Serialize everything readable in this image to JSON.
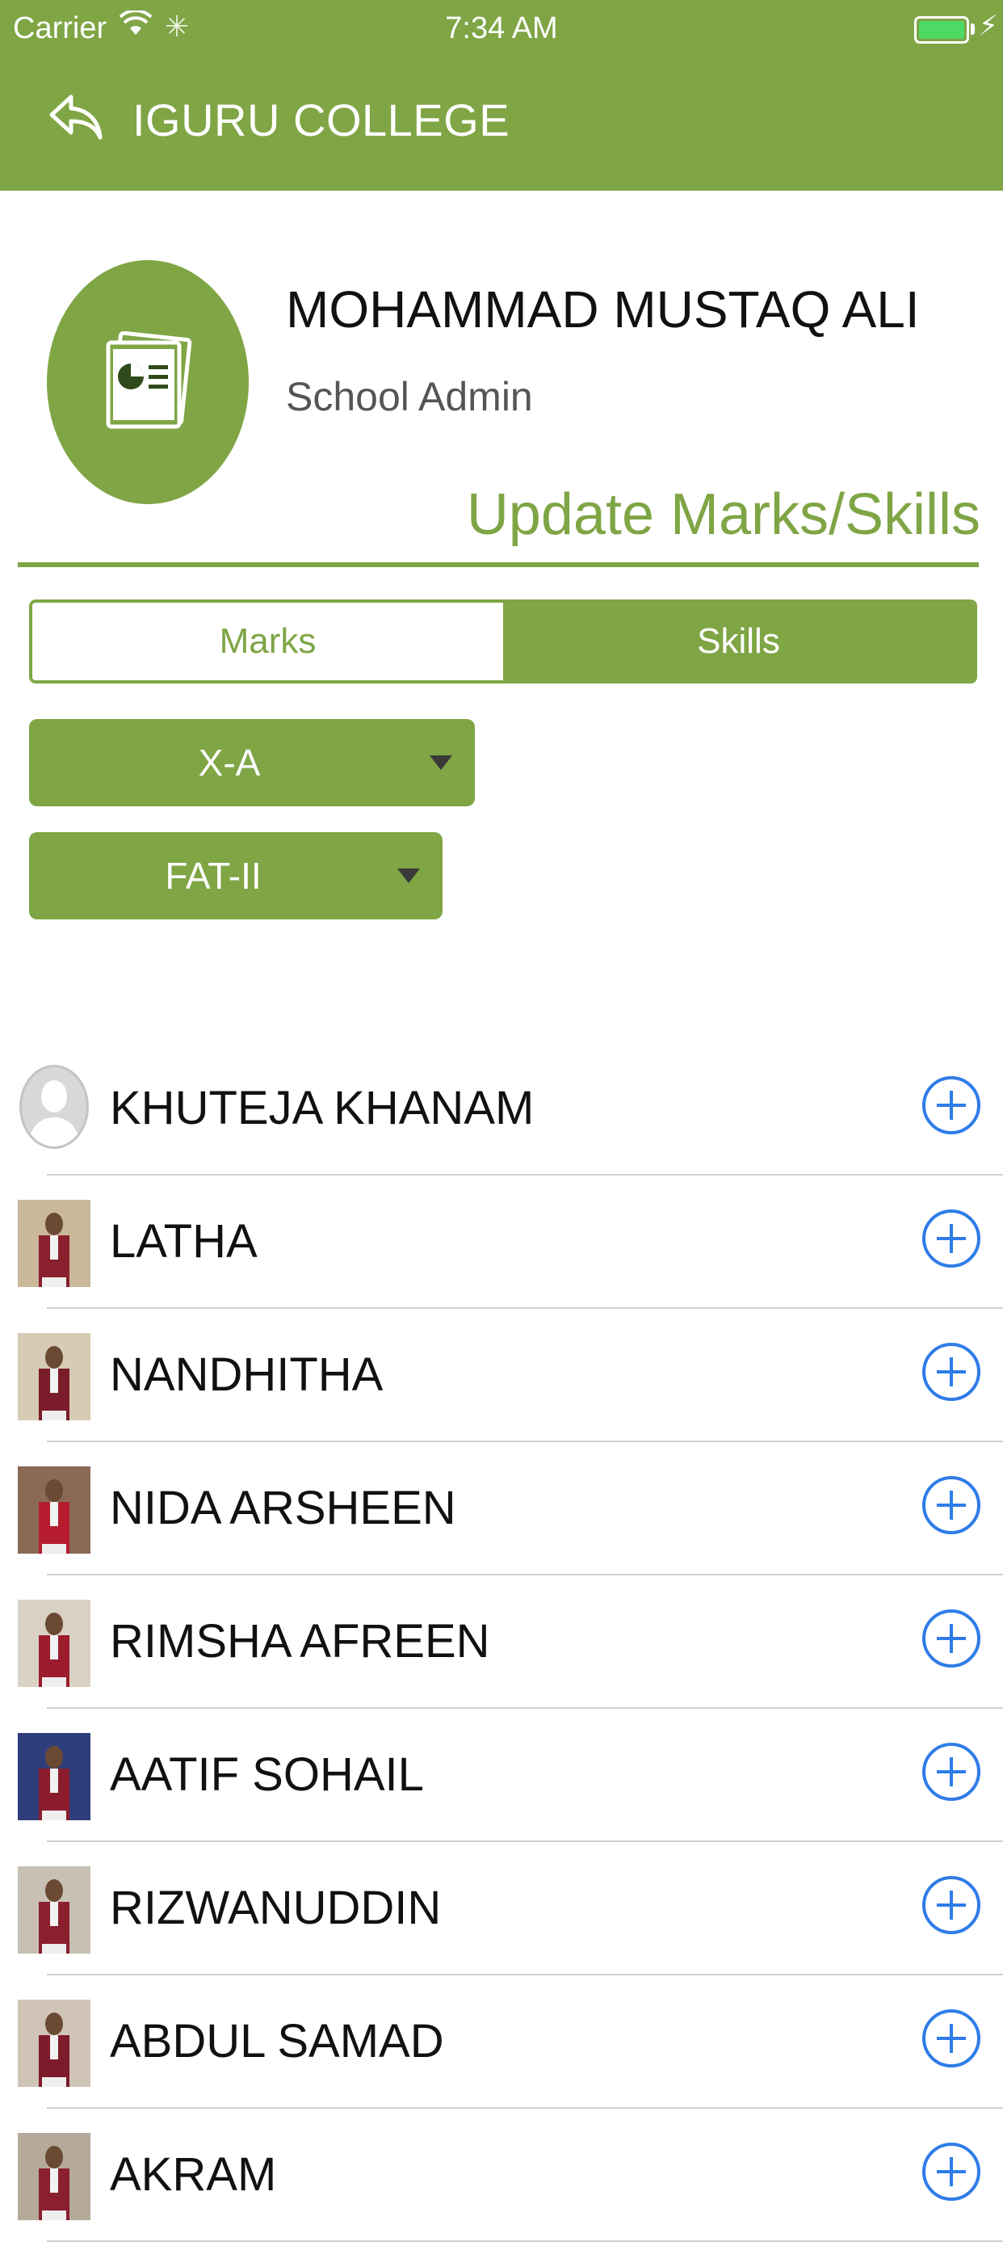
{
  "status_bar": {
    "carrier": "Carrier",
    "time": "7:34 AM"
  },
  "nav": {
    "back_icon": "back-reply-arrow-icon",
    "title": "IGURU COLLEGE"
  },
  "profile": {
    "name": "MOHAMMAD MUSTAQ ALI",
    "role": "School Admin",
    "avatar_icon": "report-document-icon"
  },
  "page": {
    "heading": "Update Marks/Skills"
  },
  "tabs": [
    {
      "label": "Marks",
      "selected": false
    },
    {
      "label": "Skills",
      "selected": true
    }
  ],
  "filters": {
    "class_value": "X-A",
    "exam_value": "FAT-II"
  },
  "students": [
    {
      "name": "KHUTEJA KHANAM",
      "photo": "placeholder"
    },
    {
      "name": "LATHA",
      "photo": "photo"
    },
    {
      "name": "NANDHITHA",
      "photo": "photo"
    },
    {
      "name": "NIDA ARSHEEN",
      "photo": "photo"
    },
    {
      "name": "RIMSHA AFREEN",
      "photo": "photo"
    },
    {
      "name": "AATIF SOHAIL",
      "photo": "photo"
    },
    {
      "name": "RIZWANUDDIN",
      "photo": "photo"
    },
    {
      "name": "ABDUL SAMAD",
      "photo": "photo"
    },
    {
      "name": "AKRAM",
      "photo": "photo"
    }
  ],
  "colors": {
    "brand_green": "#7fa545",
    "add_blue": "#2f7ce8",
    "battery_green": "#4cd964"
  }
}
